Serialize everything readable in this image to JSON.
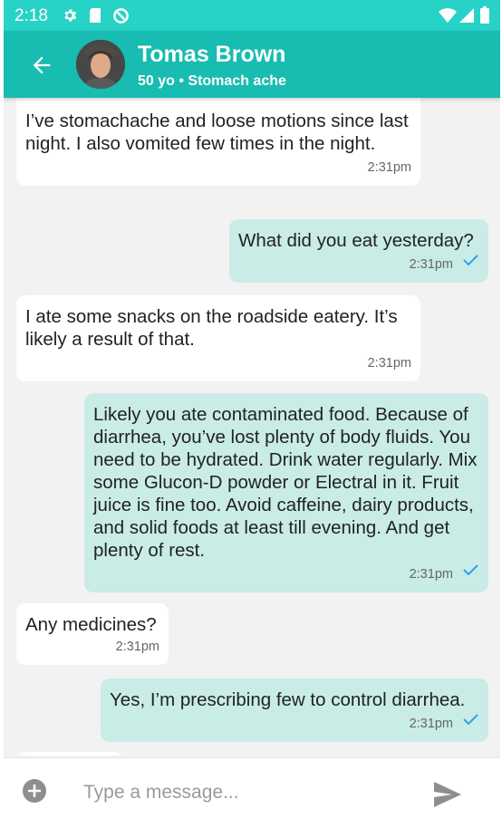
{
  "status_bar": {
    "time": "2:18",
    "icons": [
      "gear-icon",
      "sd-card-icon",
      "sync-icon",
      "wifi-icon",
      "signal-icon",
      "battery-icon"
    ]
  },
  "header": {
    "name": "Tomas Brown",
    "subtitle": "50 yo • Stomach ache",
    "icons": [
      "back-arrow-icon",
      "avatar"
    ]
  },
  "messages": [
    {
      "direction": "in",
      "text": "I’ve stomachache and loose motions since last night. I also vomited few times in the night.",
      "time": "2:31pm"
    },
    {
      "direction": "out",
      "text": "What did you eat yesterday?",
      "time": "2:31pm",
      "read": true
    },
    {
      "direction": "in",
      "text": "I ate some snacks on the roadside eatery. It’s likely a result of that.",
      "time": "2:31pm"
    },
    {
      "direction": "out",
      "text": "Likely you ate contaminated food. Because of diarrhea, you’ve lost plenty of body fluids. You need to be hydrated. Drink water regularly. Mix some Glucon-D powder or Electral in it. Fruit juice is fine too. Avoid caffeine, dairy products, and solid foods at least till evening. And get plenty of rest.",
      "time": "2:31pm",
      "read": true
    },
    {
      "direction": "in",
      "text": "Any medicines?",
      "time": "2:31pm"
    },
    {
      "direction": "out",
      "text": "Yes, I’m prescribing few to control diarrhea.",
      "time": "2:31pm",
      "read": true
    }
  ],
  "input": {
    "placeholder": "Type a message...",
    "icons": [
      "add-icon",
      "send-icon"
    ]
  },
  "colors": {
    "status_bar": "#27d2c6",
    "app_bar": "#18bcb0",
    "outgoing_bubble": "#c9ece7",
    "incoming_bubble": "#ffffff",
    "chat_background": "#f2f2f2",
    "read_check": "#2fa3e6"
  }
}
